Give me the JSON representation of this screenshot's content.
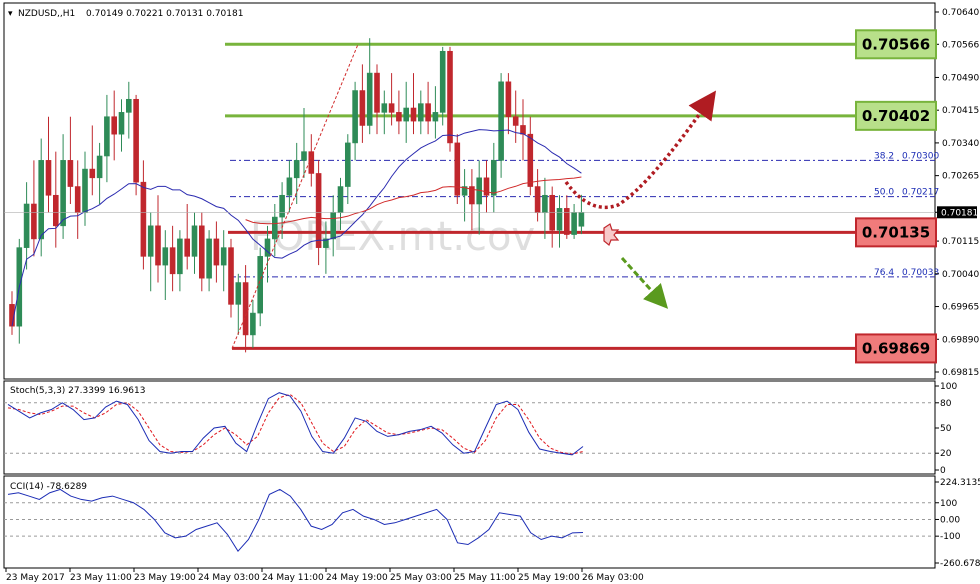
{
  "header": {
    "symbol": "NZDUSD,,H1",
    "ohlc": "0.70149 0.70221 0.70131 0.70181"
  },
  "watermark": "FOREX.mt.cov",
  "colors": {
    "bull": "#2e8b57",
    "bear": "#c0272d",
    "support_line": "#c0272d",
    "resistance_line": "#78b43c",
    "ma_fast": "#d12b2b",
    "ma_slow": "#2b2bb0"
  },
  "price_axis": {
    "ticks": [
      "0.70640",
      "0.70566",
      "0.70490",
      "0.70415",
      "0.70340",
      "0.70265",
      "0.70181",
      "0.70115",
      "0.70040",
      "0.69965",
      "0.69890",
      "0.69815"
    ],
    "current": "0.70181"
  },
  "levels": [
    {
      "name": "resistance-2",
      "label": "0.70566",
      "value": 0.70566,
      "kind": "resistance"
    },
    {
      "name": "resistance-1",
      "label": "0.70402",
      "value": 0.70402,
      "kind": "resistance"
    },
    {
      "name": "pivot",
      "label": "0.70135",
      "value": 0.70135,
      "kind": "support"
    },
    {
      "name": "support-1",
      "label": "0.69869",
      "value": 0.69869,
      "kind": "support"
    }
  ],
  "fibonacci": [
    {
      "pct": "38.2",
      "price": "0.70300",
      "value": 0.703
    },
    {
      "pct": "50.0",
      "price": "0.70217",
      "value": 0.70217
    },
    {
      "pct": "76.4",
      "price": "0.70033",
      "value": 0.70033
    }
  ],
  "stochastic": {
    "label": "Stoch(5,3,3) 27.3399 16.9613",
    "ticks": [
      "100",
      "80",
      "50",
      "20",
      "0"
    ]
  },
  "cci": {
    "label": "CCI(14) -78.6289",
    "ticks": [
      "224.3135",
      "100",
      "0.00",
      "-100",
      "-260.6785"
    ]
  },
  "time_axis": [
    "23 May 2017",
    "23 May 11:00",
    "23 May 19:00",
    "24 May 03:00",
    "24 May 11:00",
    "24 May 19:00",
    "25 May 03:00",
    "25 May 11:00",
    "25 May 19:00",
    "26 May 03:00"
  ],
  "chart_data": {
    "type": "candlestick",
    "title": "NZDUSD,,H1",
    "ylim": [
      0.69815,
      0.7064
    ],
    "ohlc_last": {
      "open": 0.70149,
      "high": 0.70221,
      "low": 0.70131,
      "close": 0.70181
    },
    "horizontal_levels": [
      0.70566,
      0.70402,
      0.70135,
      0.69869
    ],
    "fib_levels": [
      {
        "pct": 38.2,
        "price": 0.703
      },
      {
        "pct": 50.0,
        "price": 0.70217
      },
      {
        "pct": 76.4,
        "price": 0.70033
      }
    ],
    "candles": [
      {
        "o": 0.6997,
        "h": 0.7,
        "l": 0.699,
        "c": 0.6992
      },
      {
        "o": 0.6992,
        "h": 0.7012,
        "l": 0.6988,
        "c": 0.701
      },
      {
        "o": 0.701,
        "h": 0.7025,
        "l": 0.7005,
        "c": 0.702
      },
      {
        "o": 0.702,
        "h": 0.703,
        "l": 0.7008,
        "c": 0.7012
      },
      {
        "o": 0.7012,
        "h": 0.7035,
        "l": 0.7008,
        "c": 0.703
      },
      {
        "o": 0.703,
        "h": 0.704,
        "l": 0.7018,
        "c": 0.7022
      },
      {
        "o": 0.7022,
        "h": 0.7032,
        "l": 0.701,
        "c": 0.7015
      },
      {
        "o": 0.7015,
        "h": 0.7036,
        "l": 0.7012,
        "c": 0.703
      },
      {
        "o": 0.703,
        "h": 0.704,
        "l": 0.702,
        "c": 0.7024
      },
      {
        "o": 0.7024,
        "h": 0.703,
        "l": 0.7012,
        "c": 0.7018
      },
      {
        "o": 0.7018,
        "h": 0.7032,
        "l": 0.7015,
        "c": 0.7028
      },
      {
        "o": 0.7028,
        "h": 0.7038,
        "l": 0.7022,
        "c": 0.7026
      },
      {
        "o": 0.7026,
        "h": 0.7034,
        "l": 0.702,
        "c": 0.7031
      },
      {
        "o": 0.7031,
        "h": 0.7045,
        "l": 0.7025,
        "c": 0.704
      },
      {
        "o": 0.704,
        "h": 0.7046,
        "l": 0.703,
        "c": 0.7036
      },
      {
        "o": 0.7036,
        "h": 0.7044,
        "l": 0.7032,
        "c": 0.7041
      },
      {
        "o": 0.7041,
        "h": 0.7048,
        "l": 0.7035,
        "c": 0.7044
      },
      {
        "o": 0.7044,
        "h": 0.7045,
        "l": 0.7022,
        "c": 0.7025
      },
      {
        "o": 0.7025,
        "h": 0.703,
        "l": 0.7005,
        "c": 0.7008
      },
      {
        "o": 0.7008,
        "h": 0.7018,
        "l": 0.7,
        "c": 0.7015
      },
      {
        "o": 0.7015,
        "h": 0.7022,
        "l": 0.7002,
        "c": 0.7006
      },
      {
        "o": 0.7006,
        "h": 0.7014,
        "l": 0.6998,
        "c": 0.701
      },
      {
        "o": 0.701,
        "h": 0.7015,
        "l": 0.7,
        "c": 0.7004
      },
      {
        "o": 0.7004,
        "h": 0.7014,
        "l": 0.7,
        "c": 0.7012
      },
      {
        "o": 0.7012,
        "h": 0.702,
        "l": 0.7005,
        "c": 0.7008
      },
      {
        "o": 0.7008,
        "h": 0.7018,
        "l": 0.7004,
        "c": 0.7015
      },
      {
        "o": 0.7015,
        "h": 0.7018,
        "l": 0.7,
        "c": 0.7003
      },
      {
        "o": 0.7003,
        "h": 0.7014,
        "l": 0.7,
        "c": 0.7012
      },
      {
        "o": 0.7012,
        "h": 0.7016,
        "l": 0.7002,
        "c": 0.7006
      },
      {
        "o": 0.7006,
        "h": 0.7014,
        "l": 0.7,
        "c": 0.701
      },
      {
        "o": 0.701,
        "h": 0.7012,
        "l": 0.6994,
        "c": 0.6997
      },
      {
        "o": 0.6997,
        "h": 0.7004,
        "l": 0.699,
        "c": 0.7002
      },
      {
        "o": 0.7002,
        "h": 0.7006,
        "l": 0.6986,
        "c": 0.699
      },
      {
        "o": 0.699,
        "h": 0.6998,
        "l": 0.6987,
        "c": 0.6995
      },
      {
        "o": 0.6995,
        "h": 0.701,
        "l": 0.6992,
        "c": 0.7008
      },
      {
        "o": 0.7008,
        "h": 0.7015,
        "l": 0.7002,
        "c": 0.7012
      },
      {
        "o": 0.7012,
        "h": 0.702,
        "l": 0.7008,
        "c": 0.7017
      },
      {
        "o": 0.7017,
        "h": 0.7025,
        "l": 0.7012,
        "c": 0.7022
      },
      {
        "o": 0.7022,
        "h": 0.703,
        "l": 0.7018,
        "c": 0.7026
      },
      {
        "o": 0.7026,
        "h": 0.7034,
        "l": 0.702,
        "c": 0.703
      },
      {
        "o": 0.703,
        "h": 0.7042,
        "l": 0.7026,
        "c": 0.7032
      },
      {
        "o": 0.7032,
        "h": 0.7036,
        "l": 0.7024,
        "c": 0.7027
      },
      {
        "o": 0.7027,
        "h": 0.703,
        "l": 0.7006,
        "c": 0.701
      },
      {
        "o": 0.701,
        "h": 0.7016,
        "l": 0.7004,
        "c": 0.7012
      },
      {
        "o": 0.7012,
        "h": 0.7022,
        "l": 0.7008,
        "c": 0.7018
      },
      {
        "o": 0.7018,
        "h": 0.7026,
        "l": 0.7014,
        "c": 0.7024
      },
      {
        "o": 0.7024,
        "h": 0.7036,
        "l": 0.702,
        "c": 0.7034
      },
      {
        "o": 0.7034,
        "h": 0.7048,
        "l": 0.703,
        "c": 0.7046
      },
      {
        "o": 0.7046,
        "h": 0.7052,
        "l": 0.7034,
        "c": 0.7038
      },
      {
        "o": 0.7038,
        "h": 0.7058,
        "l": 0.7036,
        "c": 0.705
      },
      {
        "o": 0.705,
        "h": 0.7052,
        "l": 0.7036,
        "c": 0.7041
      },
      {
        "o": 0.7041,
        "h": 0.7046,
        "l": 0.7036,
        "c": 0.7043
      },
      {
        "o": 0.7043,
        "h": 0.705,
        "l": 0.7038,
        "c": 0.7041
      },
      {
        "o": 0.7041,
        "h": 0.7046,
        "l": 0.7036,
        "c": 0.7039
      },
      {
        "o": 0.7039,
        "h": 0.7048,
        "l": 0.7034,
        "c": 0.7042
      },
      {
        "o": 0.7042,
        "h": 0.705,
        "l": 0.7036,
        "c": 0.7039
      },
      {
        "o": 0.7039,
        "h": 0.7046,
        "l": 0.7036,
        "c": 0.7043
      },
      {
        "o": 0.7043,
        "h": 0.7048,
        "l": 0.7036,
        "c": 0.7039
      },
      {
        "o": 0.7039,
        "h": 0.7047,
        "l": 0.7035,
        "c": 0.7041
      },
      {
        "o": 0.7041,
        "h": 0.7056,
        "l": 0.7038,
        "c": 0.7055
      },
      {
        "o": 0.7055,
        "h": 0.7056,
        "l": 0.7032,
        "c": 0.7034
      },
      {
        "o": 0.7034,
        "h": 0.7036,
        "l": 0.702,
        "c": 0.7022
      },
      {
        "o": 0.7022,
        "h": 0.7028,
        "l": 0.7016,
        "c": 0.7024
      },
      {
        "o": 0.7024,
        "h": 0.7028,
        "l": 0.7014,
        "c": 0.702
      },
      {
        "o": 0.702,
        "h": 0.703,
        "l": 0.7013,
        "c": 0.7026
      },
      {
        "o": 0.7026,
        "h": 0.703,
        "l": 0.7018,
        "c": 0.7022
      },
      {
        "o": 0.7022,
        "h": 0.7034,
        "l": 0.7018,
        "c": 0.703
      },
      {
        "o": 0.703,
        "h": 0.705,
        "l": 0.7026,
        "c": 0.7048
      },
      {
        "o": 0.7048,
        "h": 0.705,
        "l": 0.7036,
        "c": 0.704
      },
      {
        "o": 0.704,
        "h": 0.7046,
        "l": 0.7034,
        "c": 0.7038
      },
      {
        "o": 0.7038,
        "h": 0.7044,
        "l": 0.703,
        "c": 0.7036
      },
      {
        "o": 0.7036,
        "h": 0.704,
        "l": 0.7022,
        "c": 0.7024
      },
      {
        "o": 0.7024,
        "h": 0.7028,
        "l": 0.7016,
        "c": 0.7018
      },
      {
        "o": 0.7018,
        "h": 0.7026,
        "l": 0.7012,
        "c": 0.7022
      },
      {
        "o": 0.7022,
        "h": 0.7024,
        "l": 0.701,
        "c": 0.7014
      },
      {
        "o": 0.7014,
        "h": 0.7022,
        "l": 0.701,
        "c": 0.7019
      },
      {
        "o": 0.7019,
        "h": 0.7022,
        "l": 0.7012,
        "c": 0.7013
      },
      {
        "o": 0.7013,
        "h": 0.702,
        "l": 0.7012,
        "c": 0.7018
      },
      {
        "o": 0.70149,
        "h": 0.70221,
        "l": 0.70131,
        "c": 0.70181
      }
    ],
    "stoch_k": [
      78,
      70,
      62,
      68,
      72,
      80,
      72,
      60,
      62,
      75,
      82,
      78,
      60,
      35,
      22,
      20,
      22,
      22,
      38,
      50,
      52,
      32,
      22,
      55,
      85,
      92,
      88,
      70,
      40,
      22,
      20,
      38,
      62,
      58,
      46,
      40,
      42,
      46,
      48,
      52,
      44,
      30,
      20,
      22,
      50,
      78,
      82,
      72,
      45,
      25,
      22,
      20,
      18,
      28
    ],
    "stoch_d": [
      74,
      72,
      68,
      66,
      70,
      76,
      76,
      68,
      62,
      68,
      78,
      80,
      70,
      50,
      30,
      22,
      21,
      22,
      30,
      42,
      50,
      42,
      30,
      40,
      68,
      86,
      90,
      80,
      56,
      32,
      22,
      28,
      48,
      60,
      52,
      44,
      42,
      44,
      47,
      50,
      48,
      38,
      26,
      21,
      35,
      62,
      78,
      78,
      60,
      38,
      26,
      21,
      19,
      22
    ],
    "cci": [
      150,
      160,
      140,
      120,
      160,
      180,
      140,
      120,
      110,
      130,
      140,
      120,
      100,
      60,
      0,
      -80,
      -110,
      -100,
      -60,
      -40,
      -20,
      -90,
      -190,
      -120,
      0,
      150,
      180,
      140,
      60,
      -40,
      -60,
      -30,
      40,
      60,
      20,
      0,
      -30,
      -20,
      0,
      20,
      40,
      60,
      0,
      -140,
      -150,
      -110,
      -60,
      40,
      30,
      20,
      -80,
      -120,
      -100,
      -110,
      -80,
      -78
    ]
  }
}
